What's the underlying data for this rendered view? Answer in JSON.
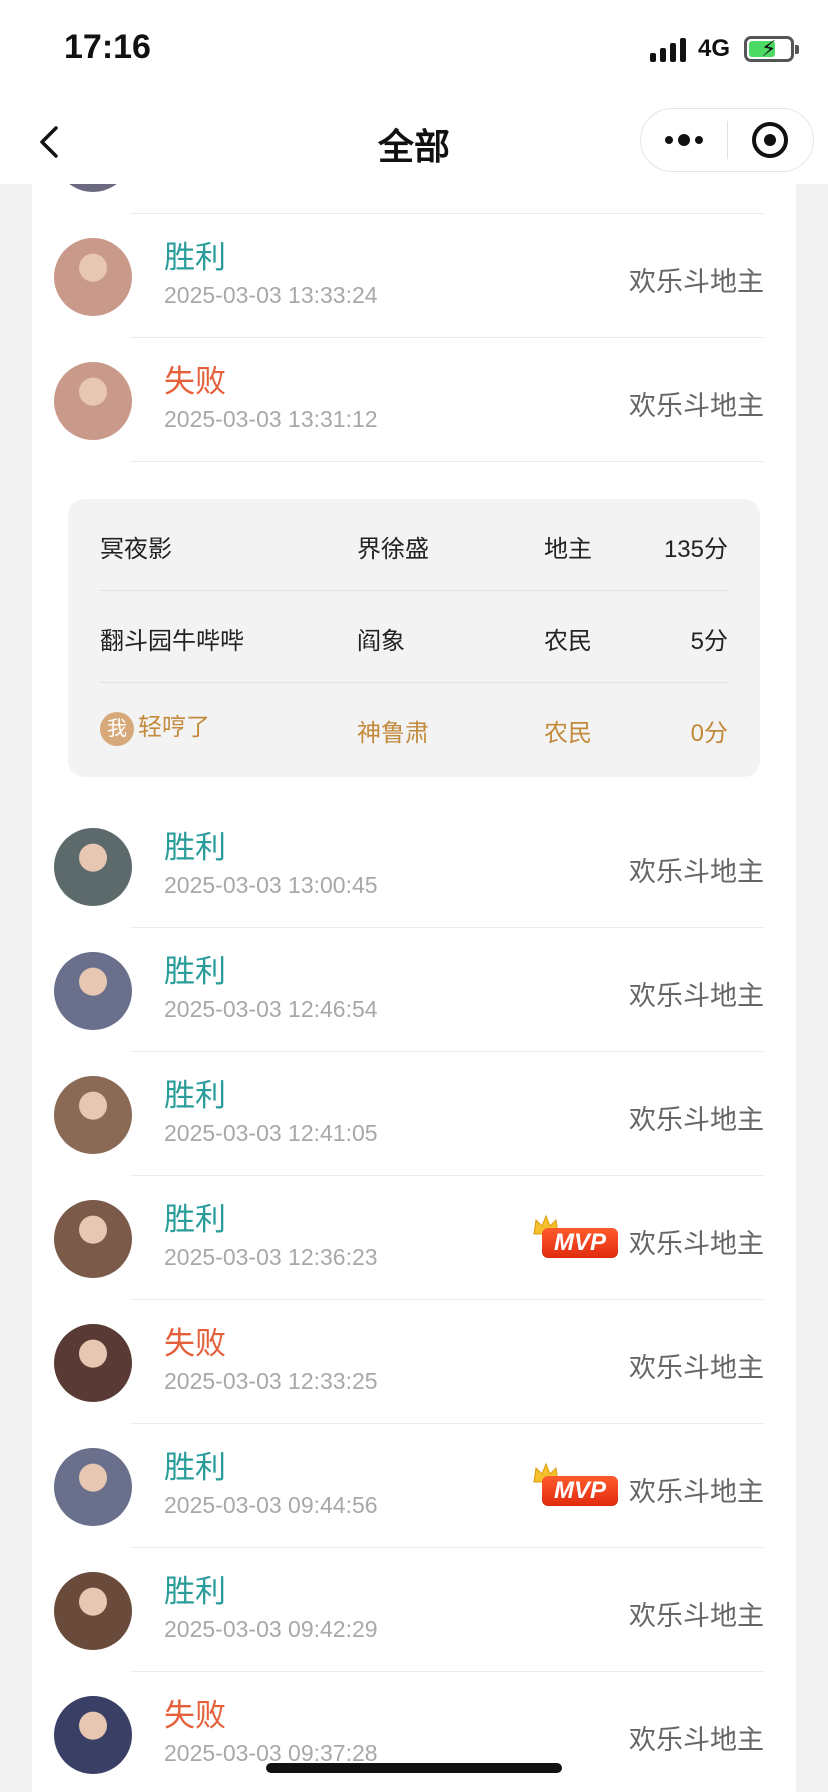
{
  "status_bar": {
    "time": "17:16",
    "network": "4G",
    "battery_color": "#4cd964"
  },
  "nav": {
    "title": "全部",
    "back_icon": "chevron-left-icon",
    "more_icon": "more-dots-icon",
    "close_icon": "target-ring-icon"
  },
  "colors": {
    "win": "#2a9d9a",
    "lose": "#e5603a",
    "me": "#c38a3c"
  },
  "records": [
    {
      "result": "胜利",
      "outcome": "win",
      "time": "2025-03-03 13:33:24",
      "mode": "欢乐斗地主",
      "mvp": false,
      "avatar_color": "#c99a8a"
    },
    {
      "result": "失败",
      "outcome": "lose",
      "time": "2025-03-03 13:31:12",
      "mode": "欢乐斗地主",
      "mvp": false,
      "avatar_color": "#c99a8a"
    },
    {
      "result": "胜利",
      "outcome": "win",
      "time": "2025-03-03 13:00:45",
      "mode": "欢乐斗地主",
      "mvp": false,
      "avatar_color": "#5d6a6c"
    },
    {
      "result": "胜利",
      "outcome": "win",
      "time": "2025-03-03 12:46:54",
      "mode": "欢乐斗地主",
      "mvp": false,
      "avatar_color": "#6a6f8c"
    },
    {
      "result": "胜利",
      "outcome": "win",
      "time": "2025-03-03 12:41:05",
      "mode": "欢乐斗地主",
      "mvp": false,
      "avatar_color": "#8a6a54"
    },
    {
      "result": "胜利",
      "outcome": "win",
      "time": "2025-03-03 12:36:23",
      "mode": "欢乐斗地主",
      "mvp": true,
      "mvp_label": "MVP",
      "avatar_color": "#7b5a4a"
    },
    {
      "result": "失败",
      "outcome": "lose",
      "time": "2025-03-03 12:33:25",
      "mode": "欢乐斗地主",
      "mvp": false,
      "avatar_color": "#5a3a34"
    },
    {
      "result": "胜利",
      "outcome": "win",
      "time": "2025-03-03 09:44:56",
      "mode": "欢乐斗地主",
      "mvp": true,
      "mvp_label": "MVP",
      "avatar_color": "#6a6f8c"
    },
    {
      "result": "胜利",
      "outcome": "win",
      "time": "2025-03-03 09:42:29",
      "mode": "欢乐斗地主",
      "mvp": false,
      "avatar_color": "#6a4a3a"
    },
    {
      "result": "失败",
      "outcome": "lose",
      "time": "2025-03-03 09:37:28",
      "mode": "欢乐斗地主",
      "mvp": false,
      "avatar_color": "#3a3f66"
    }
  ],
  "detail_rows": [
    {
      "player": "冥夜影",
      "hero": "界徐盛",
      "role": "地主",
      "score": "135分",
      "me": false
    },
    {
      "player": "翻斗园牛哔哔",
      "hero": "阎象",
      "role": "农民",
      "score": "5分",
      "me": false
    },
    {
      "player": "轻哼了",
      "hero": "神鲁肃",
      "role": "农民",
      "score": "0分",
      "me": true,
      "me_label": "我"
    }
  ]
}
